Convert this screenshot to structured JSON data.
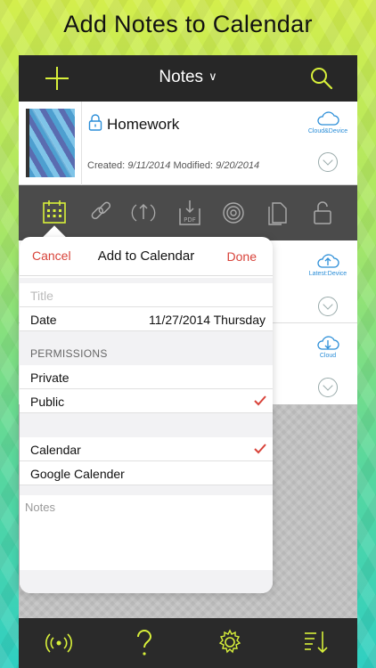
{
  "promo": {
    "title": "Add Notes to Calendar"
  },
  "topbar": {
    "title": "Notes",
    "chevron": "∨",
    "add_icon": "plus-icon",
    "search_icon": "search-icon"
  },
  "note": {
    "name": "Homework",
    "created_label": "Created:",
    "created": "9/11/2014",
    "modified_label": "Modified:",
    "modified": "9/20/2014",
    "sync_label": "Cloud&Device"
  },
  "side_labels": {
    "row2": "Latest:Device",
    "row3": "Cloud"
  },
  "icon_strip": [
    "calendar-icon",
    "link-icon",
    "share-icon",
    "pdf-icon",
    "broadcast-icon",
    "copy-icon",
    "unlock-icon"
  ],
  "popover": {
    "cancel": "Cancel",
    "title": "Add to Calendar",
    "done": "Done",
    "title_placeholder": "Title",
    "date_label": "Date",
    "date_value": "11/27/2014 Thursday",
    "permissions_header": "PERMISSIONS",
    "private": "Private",
    "public": "Public",
    "calendar": "Calendar",
    "google": "Google Calender",
    "notes_placeholder": "Notes"
  },
  "colors": {
    "accent": "#d8f03a",
    "action": "#d8433a",
    "link": "#2b8ed8"
  },
  "bottombar": [
    "broadcast-icon",
    "help-icon",
    "gear-icon",
    "sort-icon"
  ]
}
